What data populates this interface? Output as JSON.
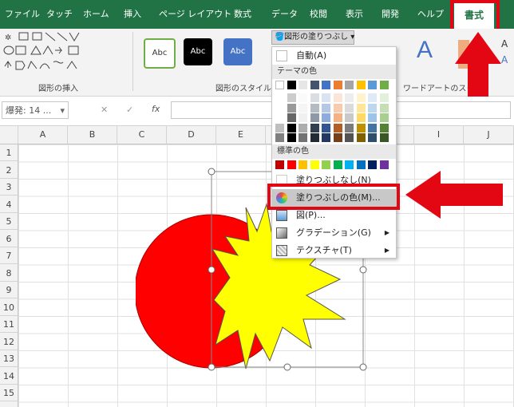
{
  "tabs": [
    "ファイル",
    "タッチ",
    "ホーム",
    "挿入",
    "ページ レイアウト",
    "数式",
    "データ",
    "校閲",
    "表示",
    "開発",
    "ヘルプ",
    "書式"
  ],
  "ribbon": {
    "insert_shapes_label": "図形の挿入",
    "shape_styles_label": "図形のスタイル",
    "wordart_label": "ワードアートのスタ",
    "style_sample": "Abc",
    "fill_button": "図形の塗りつぶし",
    "wordart_letter": "A"
  },
  "formula_bar": {
    "name_box": "爆発: 14 ...",
    "fx": "fx"
  },
  "columns": [
    "A",
    "B",
    "C",
    "D",
    "E",
    "F",
    "G",
    "H",
    "I",
    "J"
  ],
  "rows": [
    "1",
    "2",
    "3",
    "4",
    "5",
    "6",
    "7",
    "8",
    "9",
    "10",
    "11",
    "12",
    "13",
    "14",
    "15"
  ],
  "menu": {
    "auto": "自動(A)",
    "theme_header": "テーマの色",
    "standard_header": "標準の色",
    "no_fill": "塗りつぶしなし(N)",
    "more_colors": "塗りつぶしの色(M)...",
    "picture": "図(P)...",
    "gradient": "グラデーション(G)",
    "texture": "テクスチャ(T)",
    "theme_top": [
      "#ffffff",
      "#000000",
      "#e7e6e6",
      "#44546a",
      "#4472c4",
      "#ed7d31",
      "#a5a5a5",
      "#ffc000",
      "#5b9bd5",
      "#70ad47"
    ],
    "standard_colors": [
      "#c00000",
      "#ff0000",
      "#ffc000",
      "#ffff00",
      "#92d050",
      "#00b050",
      "#00b0f0",
      "#0070c0",
      "#002060",
      "#7030a0"
    ]
  },
  "colors": {
    "excel_green": "#217346",
    "highlight_red": "#e30613",
    "circle": "#ff0000",
    "burst": "#ffff00"
  }
}
